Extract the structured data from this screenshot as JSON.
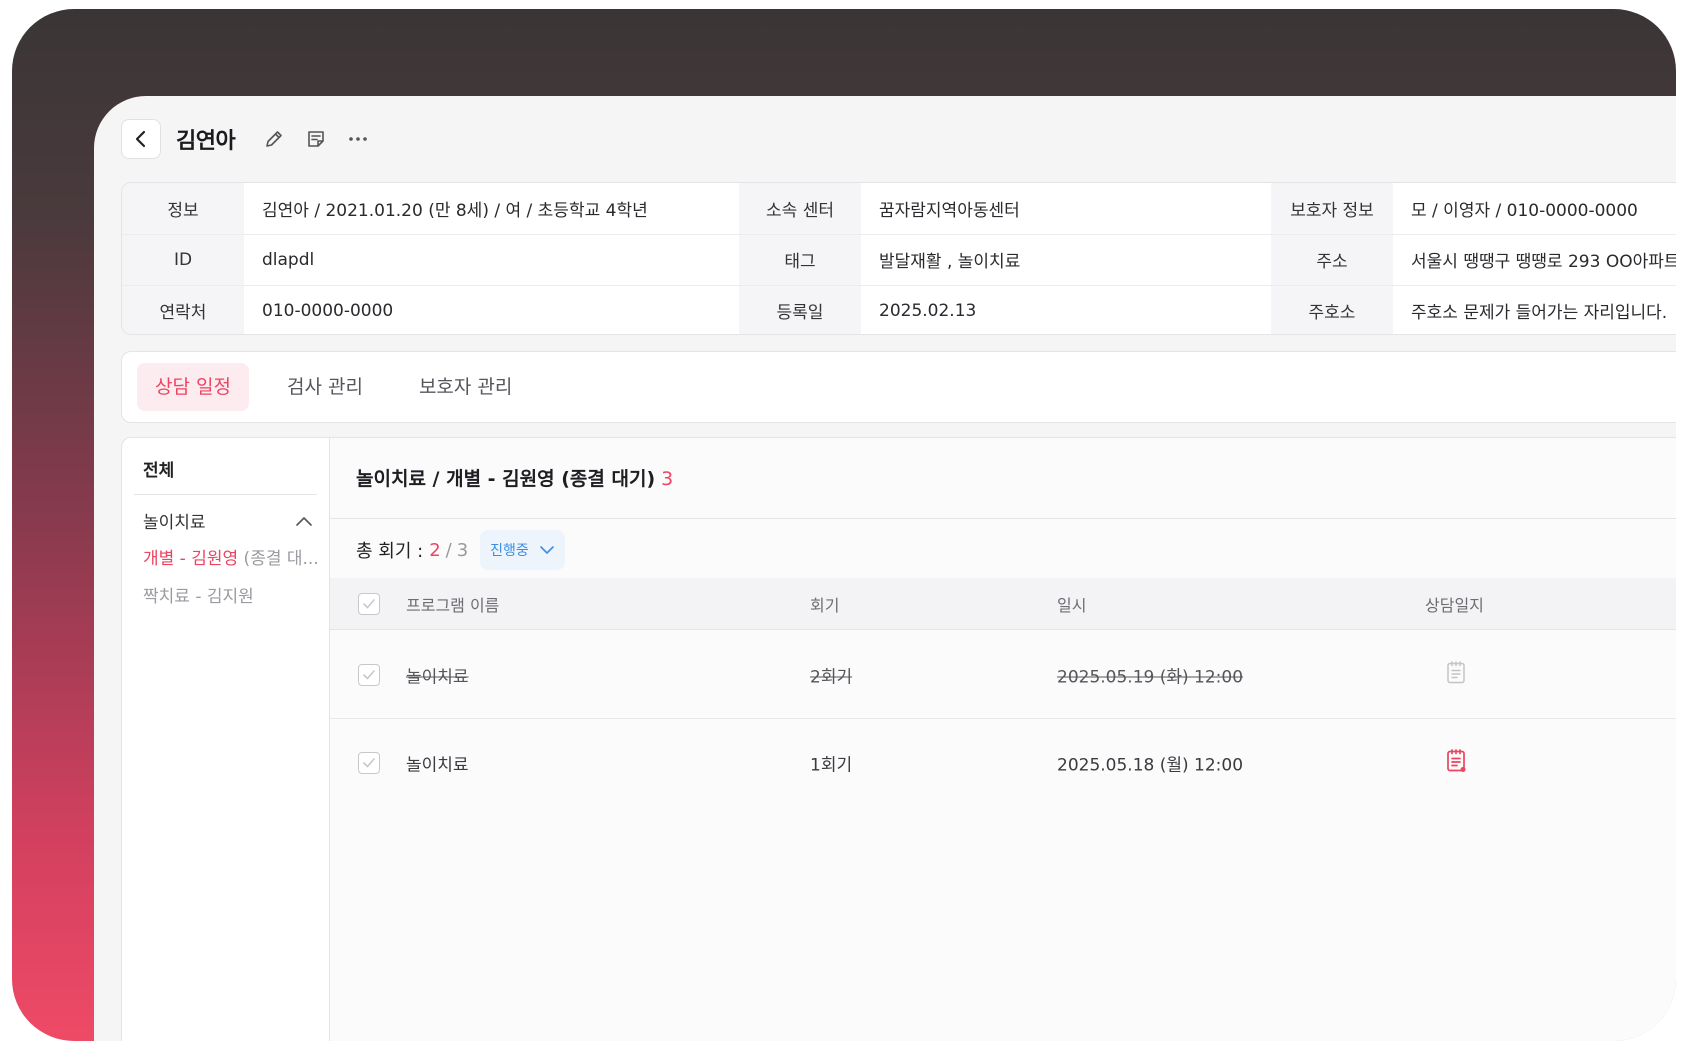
{
  "header": {
    "title": "김연아",
    "icons": [
      "chevron-left-icon",
      "edit-pencil-icon",
      "memo-icon",
      "more-icon"
    ]
  },
  "info": {
    "rows": [
      [
        {
          "label": "정보",
          "value": "김연아 / 2021.01.20 (만 8세) / 여 / 초등학교 4학년"
        },
        {
          "label": "소속 센터",
          "value": "꿈자람지역아동센터"
        },
        {
          "label": "보호자 정보",
          "value": "모 / 이영자 / 010-0000-0000"
        }
      ],
      [
        {
          "label": "ID",
          "value": "dlapdl"
        },
        {
          "label": "태그",
          "value": "발달재활 , 놀이치료"
        },
        {
          "label": "주소",
          "value": "서울시 땡땡구 땡땡로 293 OO아파트"
        }
      ],
      [
        {
          "label": "연락처",
          "value": "010-0000-0000"
        },
        {
          "label": "등록일",
          "value": "2025.02.13"
        },
        {
          "label": "주호소",
          "value": "주호소 문제가 들어가는 자리입니다."
        }
      ]
    ]
  },
  "tabs": [
    {
      "label": "상담 일정",
      "active": true
    },
    {
      "label": "검사 관리",
      "active": false
    },
    {
      "label": "보호자 관리",
      "active": false
    }
  ],
  "sidebar": {
    "all_label": "전체",
    "group_label": "놀이치료",
    "item1_main": "개별 - 김원영",
    "item1_sub": " (종결 대...",
    "item2": "짝치료 - 김지원"
  },
  "main": {
    "title": "놀이치료 / 개별 - 김원영 (종결 대기)",
    "title_count": "3",
    "summary_label": "총 회기 :",
    "summary_current": "2",
    "summary_sep": "/",
    "summary_total": "3",
    "status": "진행중",
    "columns": {
      "name": "프로그램 이름",
      "round": "회기",
      "date": "일시",
      "log": "상담일지"
    },
    "rows": [
      {
        "name": "놀이치료",
        "round": "2회기",
        "date": "2025.05.19 (화) 12:00",
        "cancelled": true
      },
      {
        "name": "놀이치료",
        "round": "1회기",
        "date": "2025.05.18 (월) 12:00",
        "cancelled": false
      }
    ]
  },
  "colors": {
    "accent": "#ec4462",
    "status_blue": "#3a8ee6"
  }
}
